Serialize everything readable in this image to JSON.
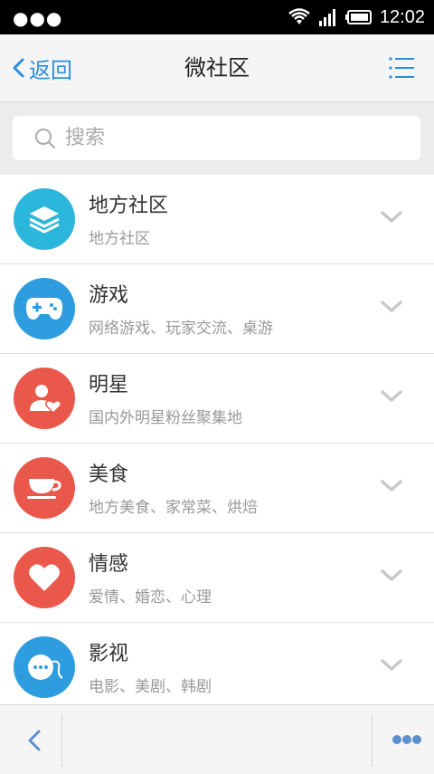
{
  "status_bar": {
    "time": "12:02",
    "icons": [
      "menu-dots-icon",
      "wifi-icon",
      "signal-icon",
      "battery-icon"
    ]
  },
  "nav": {
    "back_label": "返回",
    "title": "微社区",
    "menu_icon": "list-menu-icon",
    "accent_color": "#2a8fe0"
  },
  "search": {
    "placeholder": "搜索"
  },
  "categories": [
    {
      "title": "地方社区",
      "subtitle": "地方社区",
      "icon": "layers-icon",
      "color": "#2bb6dc"
    },
    {
      "title": "游戏",
      "subtitle": "网络游戏、玩家交流、桌游",
      "icon": "gamepad-icon",
      "color": "#2e9de0"
    },
    {
      "title": "明星",
      "subtitle": "国内外明星粉丝聚集地",
      "icon": "person-heart-icon",
      "color": "#e9584a"
    },
    {
      "title": "美食",
      "subtitle": "地方美食、家常菜、烘焙",
      "icon": "cup-icon",
      "color": "#e9584a"
    },
    {
      "title": "情感",
      "subtitle": "爱情、婚恋、心理",
      "icon": "heart-icon",
      "color": "#e9584a"
    },
    {
      "title": "影视",
      "subtitle": "电影、美剧、韩剧",
      "icon": "chat-bubble-icon",
      "color": "#2e9de0"
    }
  ],
  "bottom_bar": {
    "back_icon": "chevron-left-icon",
    "more_icon": "more-dots-icon"
  }
}
